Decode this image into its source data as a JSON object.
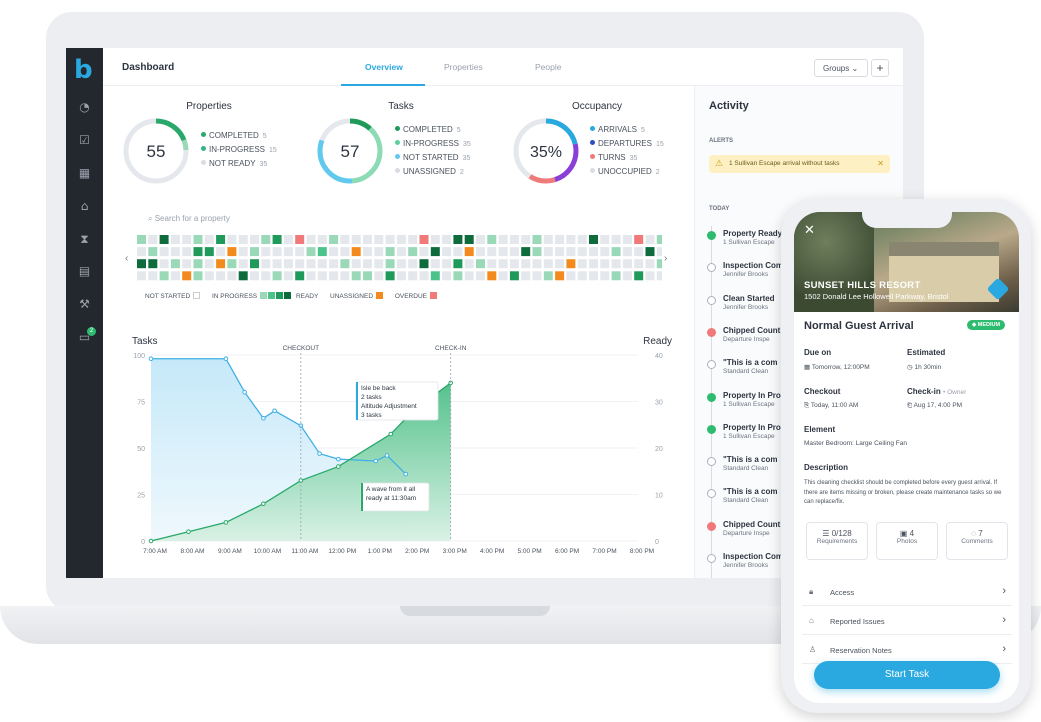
{
  "header": {
    "title": "Dashboard",
    "tabs": [
      {
        "label": "Overview"
      },
      {
        "label": "Properties"
      },
      {
        "label": "People"
      }
    ],
    "groups_label": "Groups",
    "plus": "+"
  },
  "sidebar": {
    "logo": "b",
    "icons": [
      "gauge-icon",
      "checkbox-icon",
      "calendar-icon",
      "home-icon",
      "hourglass-icon",
      "clipboard-icon",
      "wrench-icon",
      "chat-icon"
    ],
    "chat_badge": "2"
  },
  "stats": {
    "properties": {
      "title": "Properties",
      "center": "55",
      "items": [
        {
          "label": "COMPLETED",
          "value": "5",
          "color": "#2aa86a"
        },
        {
          "label": "IN-PROGRESS",
          "value": "15",
          "color": "#34b38a"
        },
        {
          "label": "NOT READY",
          "value": "35",
          "color": "#d9dde2"
        }
      ]
    },
    "tasks": {
      "title": "Tasks",
      "center": "57",
      "items": [
        {
          "label": "COMPLETED",
          "value": "5",
          "color": "#1f9a5a"
        },
        {
          "label": "IN-PROGRESS",
          "value": "35",
          "color": "#5bcf9c"
        },
        {
          "label": "NOT STARTED",
          "value": "35",
          "color": "#61c9ee"
        },
        {
          "label": "UNASSIGNED",
          "value": "2",
          "color": "#d9dde2"
        }
      ]
    },
    "occupancy": {
      "title": "Occupancy",
      "center": "35%",
      "items": [
        {
          "label": "ARRIVALS",
          "value": "5",
          "color": "#2aa9e0"
        },
        {
          "label": "DEPARTURES",
          "value": "15",
          "color": "#2f4fc0"
        },
        {
          "label": "TURNS",
          "value": "35",
          "color": "#f07a7a"
        },
        {
          "label": "UNOCCUPIED",
          "value": "2",
          "color": "#d9dde2"
        }
      ]
    }
  },
  "search": {
    "placeholder": "Search for a property"
  },
  "heat_legend": {
    "not_started": "NOT STARTED",
    "in_progress": "IN PROGRESS",
    "ready": "READY",
    "unassigned": "UNASSIGNED",
    "overdue": "OVERDUE"
  },
  "chart_data": {
    "type": "area",
    "left_label": "Tasks",
    "right_label": "Ready",
    "x": [
      "7:00 AM",
      "8:00 AM",
      "9:00 AM",
      "10:00 AM",
      "11:00 AM",
      "12:00 PM",
      "1:00 PM",
      "2:00 PM",
      "3:00 PM",
      "4:00 PM",
      "5:00 PM",
      "6:00 PM",
      "7:00 PM",
      "8:00 PM"
    ],
    "left_ticks": [
      "100",
      "75",
      "50",
      "25",
      "0"
    ],
    "right_ticks": [
      "40",
      "30",
      "20",
      "10",
      "0"
    ],
    "ylim_left": [
      0,
      100
    ],
    "ylim_right": [
      0,
      40
    ],
    "series": [
      {
        "name": "Tasks",
        "color": "#3fb0e6",
        "points": [
          [
            0,
            98
          ],
          [
            2,
            98
          ],
          [
            2.5,
            80
          ],
          [
            3,
            66
          ],
          [
            3.3,
            70
          ],
          [
            4,
            62
          ],
          [
            4.5,
            47
          ],
          [
            5,
            44
          ],
          [
            6,
            43
          ],
          [
            6.3,
            46
          ],
          [
            6.8,
            36
          ]
        ]
      },
      {
        "name": "Ready",
        "color": "#2aa86a",
        "points": [
          [
            0,
            0
          ],
          [
            1,
            2
          ],
          [
            2,
            4
          ],
          [
            3,
            8
          ],
          [
            4,
            13
          ],
          [
            5,
            16
          ],
          [
            6.4,
            23
          ],
          [
            7,
            28
          ],
          [
            8,
            34
          ]
        ]
      }
    ],
    "markers": [
      {
        "label": "CHECKOUT",
        "x": 4.0
      },
      {
        "label": "CHECK-IN",
        "x": 8.0
      }
    ],
    "tooltips": [
      {
        "lines": [
          "Isle be back",
          "2 tasks",
          "Altitude Adjustment",
          "3 tasks"
        ]
      },
      {
        "lines": [
          "A wave from it all",
          "ready at 11:30am"
        ]
      }
    ]
  },
  "activity": {
    "title": "Activity",
    "alerts_header": "ALERTS",
    "alert_text": "1 Sullivan Escape arrival without tasks",
    "today": "TODAY",
    "items": [
      {
        "title": "Property Ready",
        "sub": "1 Sullivan Escape",
        "type": "green"
      },
      {
        "title": "Inspection Comp",
        "sub": "Jennifer Brooks",
        "type": "plain"
      },
      {
        "title": "Clean Started",
        "sub": "Jennifer Brooks",
        "type": "plain"
      },
      {
        "title": "Chipped Count",
        "sub": "Departure Inspe",
        "type": "red"
      },
      {
        "title": "\"This is a com",
        "sub": "Standard Clean",
        "type": "plain"
      },
      {
        "title": "Property In Pro",
        "sub": "1 Sullivan Escape",
        "type": "green"
      },
      {
        "title": "Property In Pro",
        "sub": "1 Sullivan Escape",
        "type": "green"
      },
      {
        "title": "\"This is a com",
        "sub": "Standard Clean",
        "type": "plain"
      },
      {
        "title": "\"This is a com",
        "sub": "Standard Clean",
        "type": "plain"
      },
      {
        "title": "Chipped Count",
        "sub": "Departure Inspe",
        "type": "red"
      },
      {
        "title": "Inspection Com",
        "sub": "Jennifer Brooks",
        "type": "plain"
      }
    ]
  },
  "phone": {
    "resort": "SUNSET HILLS RESORT",
    "address": "1502 Donald Lee Hollowell Parkway, Bristol",
    "title": "Normal Guest Arrival",
    "badge": "MEDIUM",
    "due_label": "Due on",
    "due_value": "Tomorrow, 12:00PM",
    "est_label": "Estimated",
    "est_value": "1h 30min",
    "checkout_label": "Checkout",
    "checkout_value": "Today, 11:00 AM",
    "checkin_label": "Check-in",
    "checkin_sub": "• Owner",
    "checkin_value": "Aug 17, 4:00 PM",
    "element_label": "Element",
    "element_value": "Master Bedroom: Large Ceiling Fan",
    "desc_label": "Description",
    "desc_text": "This cleaning checklist should be completed before every guest arrival. If there are items missing or broken, please create maintenance tasks so we can replace/fix.",
    "tiles": [
      {
        "count": "0/128",
        "label": "Requirements"
      },
      {
        "count": "4",
        "label": "Photos"
      },
      {
        "count": "7",
        "label": "Comments"
      }
    ],
    "rows": [
      "Access",
      "Reported Issues",
      "Reservation Notes"
    ],
    "start": "Start Task"
  }
}
